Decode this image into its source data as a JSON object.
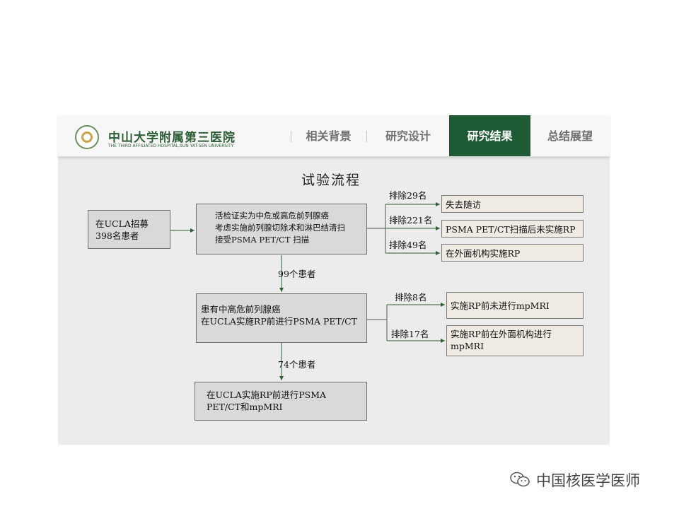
{
  "header": {
    "hospital_name_cn": "中山大学附属第三医院",
    "hospital_name_en": "THE THIRD AFFILIATED HOSPITAL,SUN YAT-SEN UNIVERSITY",
    "logo_icon": "hospital-emblem-icon",
    "tabs": [
      {
        "label": "相关背景",
        "active": false
      },
      {
        "label": "研究设计",
        "active": false
      },
      {
        "label": "研究结果",
        "active": true
      },
      {
        "label": "总结展望",
        "active": false
      }
    ],
    "active_color": "#1e5a33"
  },
  "diagram": {
    "title": "试验流程",
    "nodes": {
      "recruit": {
        "lines": [
          "在UCLA招募",
          "398名患者"
        ]
      },
      "biopsy": {
        "lines": [
          "活检证实为中危或高危前列腺癌",
          "考虑实施前列腺切除术和淋巴结清扫",
          "接受PSMA PET/CT 扫描"
        ]
      },
      "stage2": {
        "lines": [
          "患有中高危前列腺癌",
          "在UCLA实施RP前进行PSMA PET/CT"
        ]
      },
      "final": {
        "lines": [
          "在UCLA实施RP前进行PSMA",
          "PET/CT和mpMRI"
        ]
      },
      "ex1": {
        "lines": [
          "失去随访"
        ]
      },
      "ex2": {
        "lines": [
          "PSMA PET/CT扫描后未实施RP"
        ]
      },
      "ex3": {
        "lines": [
          "在外面机构实施RP"
        ]
      },
      "ex4": {
        "lines": [
          "实施RP前未进行mpMRI"
        ]
      },
      "ex5": {
        "lines": [
          "实施RP前在外面机构进行",
          "mpMRI"
        ]
      }
    },
    "edge_labels": {
      "ex1": "排除29名",
      "ex2": "排除221名",
      "ex3": "排除49名",
      "to_stage2": "99个患者",
      "ex4": "排除8名",
      "ex5": "排除17名",
      "to_final": "74个患者"
    },
    "arrow_color": "#2e5d36"
  },
  "watermark": {
    "text": "中国核医学医师",
    "icon": "wechat-icon"
  }
}
